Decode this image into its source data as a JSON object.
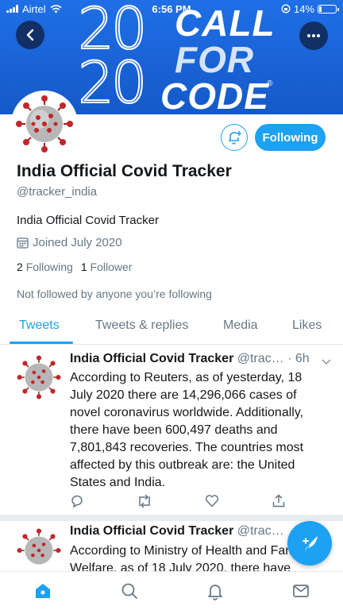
{
  "status_bar": {
    "carrier": "Airtel",
    "time": "6:56 PM",
    "battery": "14%",
    "battery_level": 0.14
  },
  "banner": {
    "line1_num": "20",
    "line1_word": "CALL",
    "line2_word": "FOR",
    "line3_num": "20",
    "line3_word": "CODE",
    "registered": "®"
  },
  "profile": {
    "name": "India Official Covid Tracker",
    "handle": "@tracker_india",
    "bio": "India Official Covid Tracker",
    "joined": "Joined July 2020",
    "following_count": "2",
    "following_label": "Following",
    "followers_count": "1",
    "followers_label": "Follower",
    "not_followed": "Not followed by anyone you’re following",
    "following_button": "Following"
  },
  "tabs": [
    "Tweets",
    "Tweets & replies",
    "Media",
    "Likes"
  ],
  "tweets": [
    {
      "name": "India Official Covid Tracker",
      "handle": "@trac…",
      "dot": " · ",
      "time": "6h",
      "body": "According to Reuters, as of yesterday, 18 July 2020 there are 14,296,066 cases of novel coronavirus worldwide. Additionally, there have been 600,497 deaths and 7,801,843 recoveries. The countries most affected by this outbreak are: the United States and India."
    },
    {
      "name": "India Official Covid Tracker",
      "handle": "@trac…",
      "body": "According to Ministry of Health and Family Welfare, as of 18 July 2020, there have"
    }
  ],
  "colors": {
    "accent": "#1da1f2",
    "banner": "#1f6fe6"
  },
  "icons": [
    "back-arrow-icon",
    "more-icon",
    "notification-bell-plus-icon",
    "calendar-icon",
    "reply-icon",
    "retweet-icon",
    "like-icon",
    "share-icon",
    "compose-icon",
    "home-icon",
    "search-icon",
    "notifications-icon",
    "messages-icon"
  ]
}
